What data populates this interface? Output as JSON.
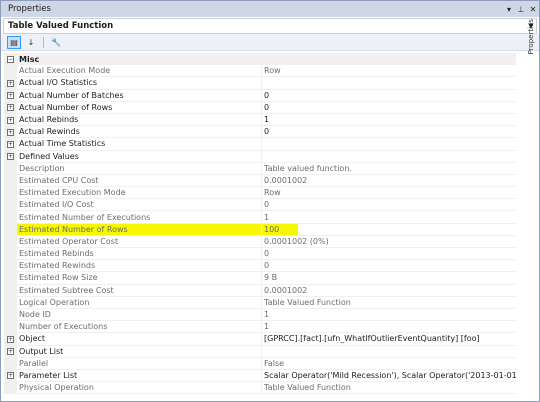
{
  "window": {
    "title": "Properties"
  },
  "selector": {
    "text": "Table Valued Function"
  },
  "side_tab": "Properties",
  "rows": [
    {
      "type": "cat",
      "name": "Misc",
      "value": "",
      "expander": "−"
    },
    {
      "type": "ro",
      "name": "Actual Execution Mode",
      "value": "Row",
      "expander": ""
    },
    {
      "type": "rw",
      "name": "Actual I/O Statistics",
      "value": "",
      "expander": "+"
    },
    {
      "type": "rw",
      "name": "Actual Number of Batches",
      "value": "0",
      "expander": "+"
    },
    {
      "type": "rw",
      "name": "Actual Number of Rows",
      "value": "0",
      "expander": "+"
    },
    {
      "type": "rw",
      "name": "Actual Rebinds",
      "value": "1",
      "expander": "+"
    },
    {
      "type": "rw",
      "name": "Actual Rewinds",
      "value": "0",
      "expander": "+"
    },
    {
      "type": "rw",
      "name": "Actual Time Statistics",
      "value": "",
      "expander": "+"
    },
    {
      "type": "rw",
      "name": "Defined Values",
      "value": "",
      "expander": "+"
    },
    {
      "type": "ro",
      "name": "Description",
      "value": "Table valued function.",
      "expander": ""
    },
    {
      "type": "ro",
      "name": "Estimated CPU Cost",
      "value": "0.0001002",
      "expander": ""
    },
    {
      "type": "ro",
      "name": "Estimated Execution Mode",
      "value": "Row",
      "expander": ""
    },
    {
      "type": "ro",
      "name": "Estimated I/O Cost",
      "value": "0",
      "expander": ""
    },
    {
      "type": "ro",
      "name": "Estimated Number of Executions",
      "value": "1",
      "expander": ""
    },
    {
      "type": "ro hl",
      "name": "Estimated Number of Rows",
      "value": "100",
      "expander": ""
    },
    {
      "type": "ro",
      "name": "Estimated Operator Cost",
      "value": "0.0001002 (0%)",
      "expander": ""
    },
    {
      "type": "ro",
      "name": "Estimated Rebinds",
      "value": "0",
      "expander": ""
    },
    {
      "type": "ro",
      "name": "Estimated Rewinds",
      "value": "0",
      "expander": ""
    },
    {
      "type": "ro",
      "name": "Estimated Row Size",
      "value": "9 B",
      "expander": ""
    },
    {
      "type": "ro",
      "name": "Estimated Subtree Cost",
      "value": "0.0001002",
      "expander": ""
    },
    {
      "type": "ro",
      "name": "Logical Operation",
      "value": "Table Valued Function",
      "expander": ""
    },
    {
      "type": "ro",
      "name": "Node ID",
      "value": "1",
      "expander": ""
    },
    {
      "type": "ro",
      "name": "Number of Executions",
      "value": "1",
      "expander": ""
    },
    {
      "type": "rw",
      "name": "Object",
      "value": "[GPRCC].[fact].[ufn_WhatIfOutlierEventQuantity] [foo]",
      "expander": "+"
    },
    {
      "type": "rw",
      "name": "Output List",
      "value": "",
      "expander": "+"
    },
    {
      "type": "ro",
      "name": "Parallel",
      "value": "False",
      "expander": ""
    },
    {
      "type": "rw",
      "name": "Parameter List",
      "value": "Scalar Operator('Mild Recession'), Scalar Operator('2013-01-01'), Scalar Operator('2",
      "expander": "+"
    },
    {
      "type": "ro",
      "name": "Physical Operation",
      "value": "Table Valued Function",
      "expander": ""
    }
  ]
}
